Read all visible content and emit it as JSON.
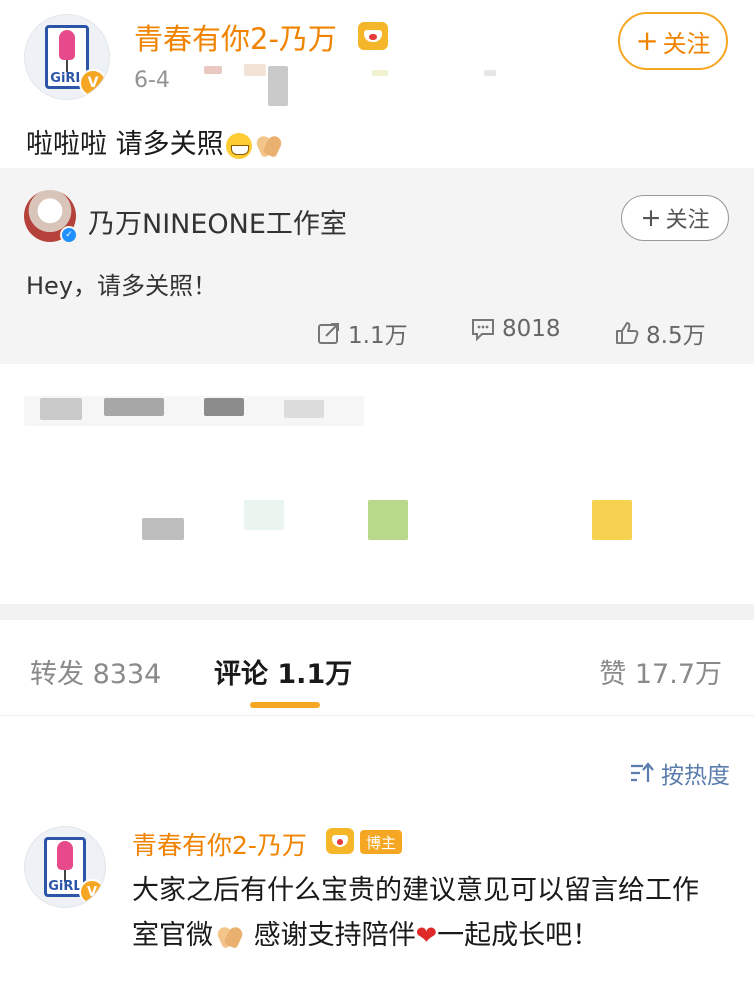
{
  "post": {
    "author": "青春有你2-乃万",
    "time": "6-4",
    "follow_label": "关注",
    "text": "啦啦啦 请多关照",
    "avatar_text": "GiRL",
    "verified_mark": "V"
  },
  "repost": {
    "author": "乃万NINEONE工作室",
    "follow_label": "关注",
    "text": "Hey，请多关照！",
    "stats": {
      "reposts": "1.1万",
      "comments": "8018",
      "likes": "8.5万"
    }
  },
  "tabs": {
    "repost": "转发 8334",
    "comment": "评论 1.1万",
    "like": "赞 17.7万"
  },
  "sort": {
    "label": "按热度"
  },
  "comment": {
    "author": "青春有你2-乃万",
    "badge": "博主",
    "avatar_text": "GiRL",
    "verified_mark": "V",
    "text_part1": "大家之后有什么宝贵的建议意见可以留言给工作室官微",
    "text_part2": " 感谢支持陪伴",
    "text_part3": "一起成长吧！"
  },
  "colors": {
    "accent_orange": "#f08300",
    "badge_yellow": "#f5a623",
    "link_blue": "#5a7dad",
    "background_gray": "#f4f4f4"
  },
  "icons": [
    "crown-icon",
    "plus-icon",
    "grin-emoji",
    "clap-emoji",
    "repost-icon",
    "comment-icon",
    "like-icon",
    "sort-icon",
    "heart-emoji"
  ]
}
